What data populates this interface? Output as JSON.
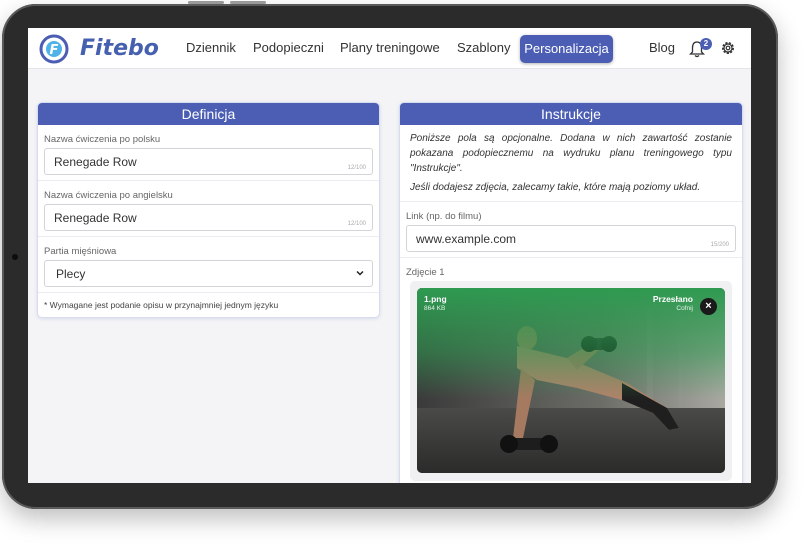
{
  "brand": {
    "name": "Fitebo",
    "logo_letter": "F"
  },
  "nav": {
    "items": [
      "Dziennik",
      "Podopieczni",
      "Plany treningowe",
      "Szablony"
    ],
    "active": "Personalizacja",
    "blog": "Blog",
    "notifications_count": "2"
  },
  "definition": {
    "title": "Definicja",
    "name_pl_label": "Nazwa ćwiczenia po polsku",
    "name_pl_value": "Renegade Row",
    "name_pl_counter": "12/100",
    "name_en_label": "Nazwa ćwiczenia po angielsku",
    "name_en_value": "Renegade Row",
    "name_en_counter": "12/100",
    "muscle_label": "Partia mięśniowa",
    "muscle_value": "Plecy",
    "note": "* Wymagane jest podanie opisu w przynajmniej jednym języku"
  },
  "instructions": {
    "title": "Instrukcje",
    "info1": "Poniższe pola są opcjonalne. Dodana w nich zawartość zostanie pokazana podopiecznemu na wydruku planu treningowego typu \"Instrukcje\".",
    "info2": "Jeśli dodajesz zdjęcia, zalecamy takie, które mają poziomy układ.",
    "link_label": "Link (np. do filmu)",
    "link_value": "www.example.com",
    "link_counter": "15/200",
    "photo_label": "Zdjęcie 1",
    "file_name": "1.png",
    "file_size": "864 KB",
    "status": "Przesłano",
    "undo": "Cofnij",
    "close": "×"
  },
  "colors": {
    "accent": "#4b5eb4",
    "upload_green": "#2e9a50"
  }
}
